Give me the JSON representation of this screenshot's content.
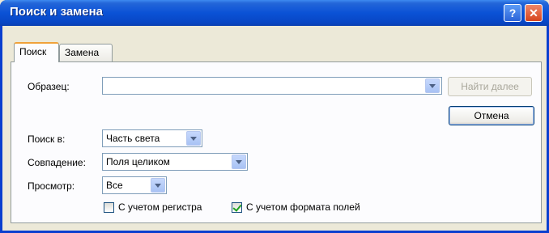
{
  "window": {
    "title": "Поиск и замена",
    "help_label": "?",
    "close_label": "✕"
  },
  "tabs": [
    {
      "label": "Поиск",
      "active": true
    },
    {
      "label": "Замена",
      "active": false
    }
  ],
  "form": {
    "pattern": {
      "label": "Образец:",
      "value": ""
    },
    "search_in": {
      "label": "Поиск в:",
      "value": "Часть света"
    },
    "match": {
      "label": "Совпадение:",
      "value": "Поля целиком"
    },
    "direction": {
      "label": "Просмотр:",
      "value": "Все"
    },
    "match_case": {
      "label": "С учетом регистра",
      "checked": false
    },
    "match_format": {
      "label": "С учетом формата полей",
      "checked": true
    }
  },
  "buttons": {
    "find_next": "Найти далее",
    "cancel": "Отмена"
  },
  "colors": {
    "titlebar": "#0a52d6",
    "dialog_bg": "#ece9d8",
    "field_border": "#7f9db9"
  }
}
